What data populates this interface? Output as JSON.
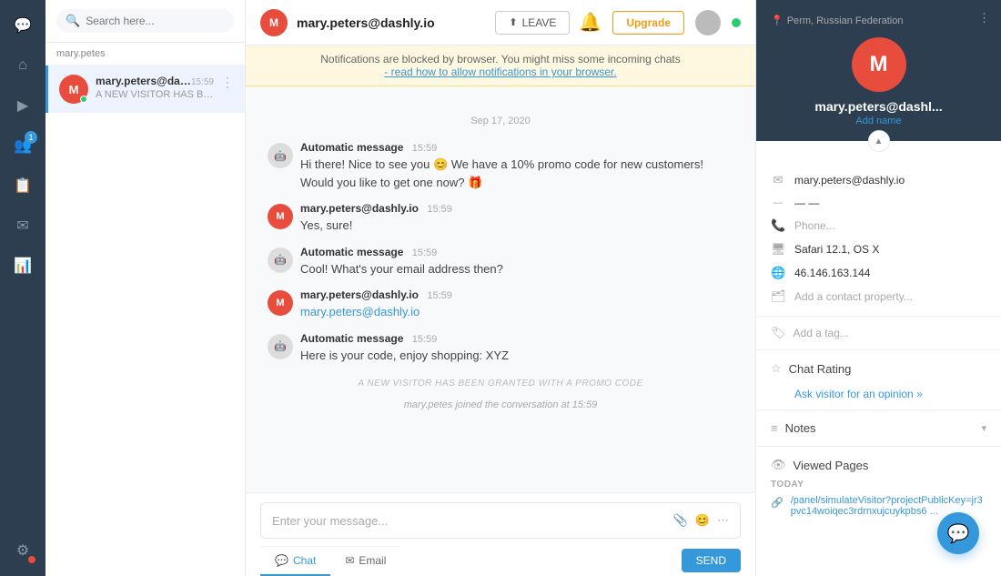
{
  "sidebar": {
    "icons": [
      {
        "name": "chat-icon",
        "symbol": "💬",
        "active": true
      },
      {
        "name": "home-icon",
        "symbol": "⌂",
        "active": false
      },
      {
        "name": "play-icon",
        "symbol": "▶",
        "active": false
      },
      {
        "name": "team-icon",
        "symbol": "👥",
        "active": false,
        "badge": "1"
      },
      {
        "name": "report-icon",
        "symbol": "📋",
        "active": false
      },
      {
        "name": "email-icon",
        "symbol": "✉",
        "active": false
      },
      {
        "name": "chart-icon",
        "symbol": "📊",
        "active": false
      },
      {
        "name": "settings-icon",
        "symbol": "⚙",
        "active": false,
        "dot": true
      }
    ]
  },
  "conv_list": {
    "search_placeholder": "Search here...",
    "filter_label": "mary.petes",
    "items": [
      {
        "id": "conv-1",
        "name": "mary.peters@dashly.io",
        "preview": "A NEW VISITOR HAS BEEN GRA...",
        "time": "15:59",
        "initials": "M",
        "active": true
      }
    ]
  },
  "chat": {
    "header": {
      "user": "mary.peters@dashly.io",
      "initials": "M",
      "leave_btn": "LEAVE"
    },
    "notification": {
      "text": "Notifications are blocked by browser. You might miss some incoming chats",
      "link_text": "- read how to allow notifications in your browser."
    },
    "date_divider": "Sep 17, 2020",
    "messages": [
      {
        "id": "msg-1",
        "sender": "Automatic message",
        "time": "15:59",
        "text": "Hi there! Nice to see you 😊 We have a 10% promo code for new customers! Would you like to get one now? 🎁",
        "type": "bot"
      },
      {
        "id": "msg-2",
        "sender": "mary.peters@dashly.io",
        "time": "15:59",
        "text": "Yes, sure!",
        "type": "user"
      },
      {
        "id": "msg-3",
        "sender": "Automatic message",
        "time": "15:59",
        "text": "Cool! What's your email address then?",
        "type": "bot"
      },
      {
        "id": "msg-4",
        "sender": "mary.peters@dashly.io",
        "time": "15:59",
        "text": "mary.peters@dashly.io",
        "link": true,
        "type": "user"
      },
      {
        "id": "msg-5",
        "sender": "Automatic message",
        "time": "15:59",
        "text": "Here is your code, enjoy shopping: XYZ",
        "type": "bot"
      }
    ],
    "system_messages": [
      "A NEW VISITOR HAS BEEN GRANTED WITH A PROMO CODE",
      "mary.petes joined the conversation at 15:59"
    ],
    "input_placeholder": "Enter your message...",
    "input_tabs": [
      {
        "label": "Chat",
        "icon": "💬",
        "active": true
      },
      {
        "label": "Email",
        "icon": "✉",
        "active": false
      }
    ],
    "send_btn": "SEND"
  },
  "right_panel": {
    "hero": {
      "location": "Perm, Russian Federation",
      "name": "mary.peters@dashl...",
      "initials": "M",
      "add_name": "Add name"
    },
    "contact_info": {
      "email": "mary.peters@dashly.io",
      "phone_placeholder": "Phone...",
      "browser": "Safari 12.1, OS X",
      "ip": "46.146.163.144",
      "add_property": "Add a contact property..."
    },
    "tag_placeholder": "Add a tag...",
    "chat_rating": {
      "title": "Chat Rating",
      "link": "Ask visitor for an opinion »"
    },
    "notes": {
      "title": "Notes"
    },
    "viewed_pages": {
      "title": "Viewed Pages",
      "today_label": "TODAY",
      "pages": [
        {
          "url": "/panel/simulateVisitor?projectPublicKey=jr3pvc14woiqec3rdrnxujcuykpbs6 ..."
        }
      ]
    }
  }
}
